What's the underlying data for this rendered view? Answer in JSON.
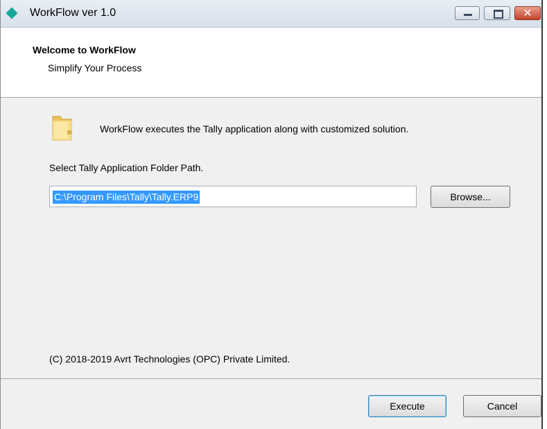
{
  "window": {
    "title": "WorkFlow ver 1.0"
  },
  "titlebar": {
    "minimize": "minimize",
    "maximize": "maximize",
    "close": "✕"
  },
  "header": {
    "title": "Welcome to WorkFlow",
    "subtitle": "Simplify Your Process"
  },
  "body": {
    "description": "WorkFlow executes the Tally application along with customized solution.",
    "select_label": "Select Tally Application Folder Path.",
    "folder_path": "C:\\Program Files\\Tally\\Tally.ERP9",
    "browse_label": "Browse..."
  },
  "footer": {
    "copyright": "(C) 2018-2019 Avrt Technologies (OPC) Private Limited.",
    "execute_label": "Execute",
    "cancel_label": "Cancel"
  },
  "colors": {
    "selection": "#3399ff",
    "app_icon": "#17a89a",
    "close_button": "#c4432b"
  }
}
